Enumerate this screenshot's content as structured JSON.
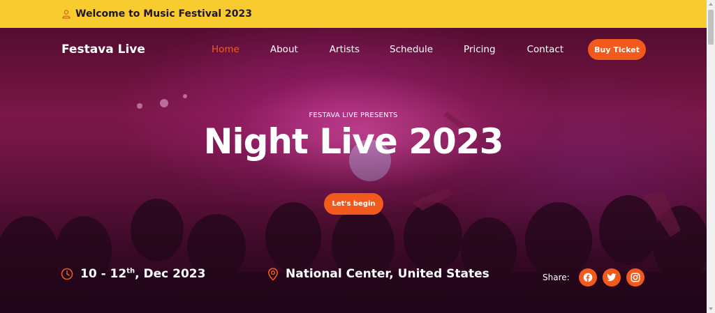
{
  "topbar": {
    "icon": "user-icon",
    "text": "Welcome to Music Festival 2023"
  },
  "header": {
    "brand": "Festava Live",
    "nav": [
      "Home",
      "About",
      "Artists",
      "Schedule",
      "Pricing",
      "Contact"
    ],
    "active": "Home",
    "buy_label": "Buy Ticket"
  },
  "hero": {
    "presents": "FESTAVA LIVE PRESENTS",
    "title": "Night Live 2023",
    "cta_label": "Let's begin",
    "date_prefix": "10 - 12",
    "date_sup": "th",
    "date_suffix": ", Dec 2023",
    "location": "National Center, United States",
    "share_label": "Share:",
    "social": [
      "facebook-icon",
      "twitter-icon",
      "instagram-icon"
    ]
  },
  "colors": {
    "accent": "#f15a1c",
    "topbar": "#f8cb2e",
    "hero": "#7c1748"
  }
}
